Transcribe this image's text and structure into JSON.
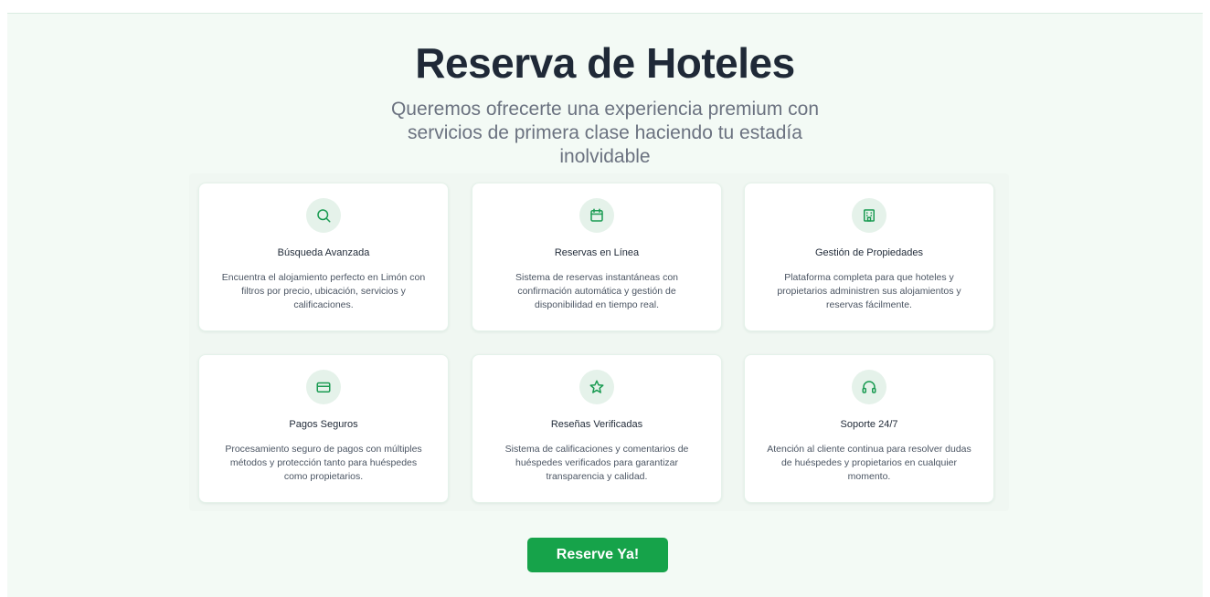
{
  "hero": {
    "title": "Reserva de Hoteles",
    "subtitle": "Queremos ofrecerte una experiencia premium con servicios de primera clase haciendo tu estadía inolvidable"
  },
  "features": [
    {
      "icon": "search-icon",
      "title": "Búsqueda Avanzada",
      "description": "Encuentra el alojamiento perfecto en Limón con filtros por precio, ubicación, servicios y calificaciones."
    },
    {
      "icon": "calendar-icon",
      "title": "Reservas en Línea",
      "description": "Sistema de reservas instantáneas con confirmación automática y gestión de disponibilidad en tiempo real."
    },
    {
      "icon": "building-icon",
      "title": "Gestión de Propiedades",
      "description": "Plataforma completa para que hoteles y propietarios administren sus alojamientos y reservas fácilmente."
    },
    {
      "icon": "credit-card-icon",
      "title": "Pagos Seguros",
      "description": "Procesamiento seguro de pagos con múltiples métodos y protección tanto para huéspedes como propietarios."
    },
    {
      "icon": "star-icon",
      "title": "Reseñas Verificadas",
      "description": "Sistema de calificaciones y comentarios de huéspedes verificados para garantizar transparencia y calidad."
    },
    {
      "icon": "headphones-icon",
      "title": "Soporte 24/7",
      "description": "Atención al cliente continua para resolver dudas de huéspedes y propietarios en cualquier momento."
    }
  ],
  "cta": {
    "label": "Reserve Ya!"
  },
  "colors": {
    "accent": "#16a34a",
    "icon_bg": "#e5f2ea",
    "page_bg": "#f3faf5"
  }
}
